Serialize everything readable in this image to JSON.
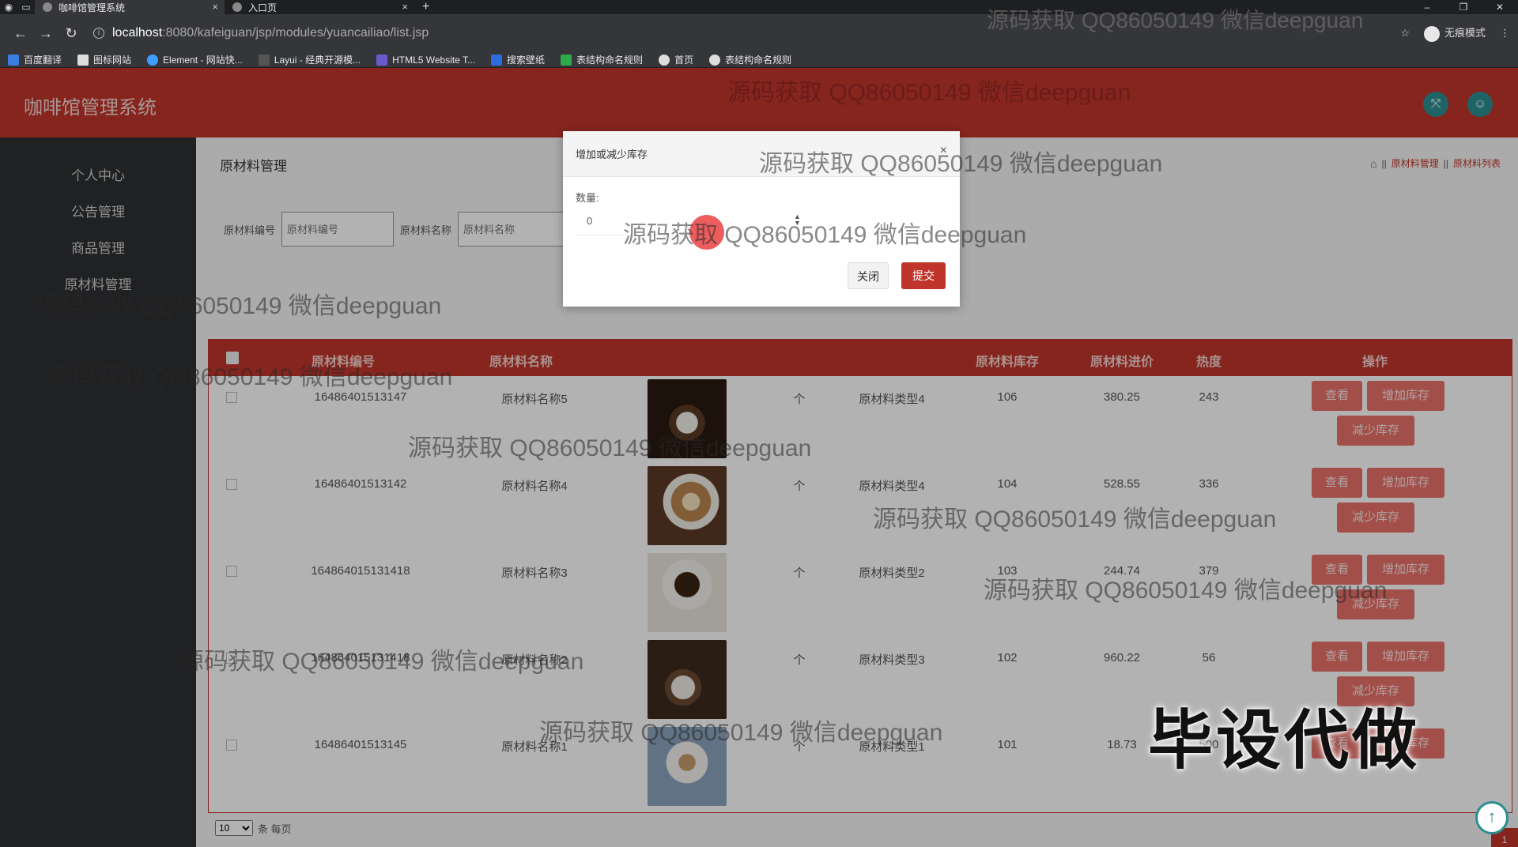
{
  "browser": {
    "tabs": [
      {
        "title": "咖啡馆管理系统",
        "active": true
      },
      {
        "title": "入口页",
        "active": false
      }
    ],
    "url_host": "localhost",
    "url_path": ":8080/kafeiguan/jsp/modules/yuancailiao/list.jsp",
    "profile_label": "无痕模式",
    "bookmarks": [
      "百度翻译",
      "图标网站",
      "Element - 网站快...",
      "Layui - 经典开源模...",
      "HTML5 Website T...",
      "搜索壁纸",
      "表结构命名规则",
      "首页",
      "表结构命名规则"
    ]
  },
  "app": {
    "title": "咖啡馆管理系统",
    "sidebar": [
      "个人中心",
      "公告管理",
      "商品管理",
      "原材料管理"
    ],
    "page_title": "原材料管理",
    "breadcrumb": [
      "原材料管理",
      "原材料列表"
    ],
    "search": {
      "code_label": "原材料编号",
      "code_placeholder": "原材料编号",
      "name_label": "原材料名称",
      "name_placeholder": "原材料名称"
    },
    "columns": [
      "原材料编号",
      "原材料名称",
      "原材料库存",
      "原材料进价",
      "热度",
      "操作"
    ],
    "rows": [
      {
        "code": "16486401513147",
        "name": "原材料名称5",
        "unit": "个",
        "type": "原材料类型4",
        "stock": "106",
        "price": "380.25",
        "heat": "243"
      },
      {
        "code": "16486401513142",
        "name": "原材料名称4",
        "unit": "个",
        "type": "原材料类型4",
        "stock": "104",
        "price": "528.55",
        "heat": "336"
      },
      {
        "code": "164864015131418",
        "name": "原材料名称3",
        "unit": "个",
        "type": "原材料类型2",
        "stock": "103",
        "price": "244.74",
        "heat": "379"
      },
      {
        "code": "164864015131418",
        "name": "原材料名称2",
        "unit": "个",
        "type": "原材料类型3",
        "stock": "102",
        "price": "960.22",
        "heat": "56"
      },
      {
        "code": "16486401513145",
        "name": "原材料名称1",
        "unit": "个",
        "type": "原材料类型1",
        "stock": "101",
        "price": "18.73",
        "heat": "500"
      }
    ],
    "actions": {
      "view": "查看",
      "add": "增加库存",
      "minus": "减少库存"
    },
    "pager": {
      "page_size": "10",
      "per_page_label": "条 每页",
      "current_page": "1"
    }
  },
  "modal": {
    "title": "增加或减少库存",
    "close_x": "×",
    "qty_label": "数量:",
    "qty_value": "0",
    "close_label": "关闭",
    "submit_label": "提交"
  },
  "watermarks": {
    "text": "源码获取 QQ86050149 微信deepguan",
    "corner_text": "毕设代做"
  },
  "colors": {
    "brand": "#c0352b",
    "button": "#e8716a",
    "accent": "#2b8f92"
  }
}
